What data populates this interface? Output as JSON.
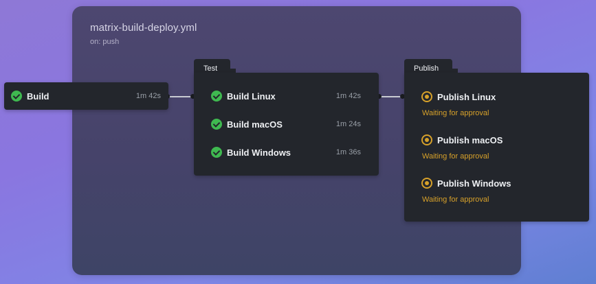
{
  "workflow": {
    "title": "matrix-build-deploy.yml",
    "trigger": "on: push"
  },
  "build_job": {
    "name": "Build",
    "duration": "1m 42s",
    "status": "success"
  },
  "test_group": {
    "label": "Test",
    "jobs": [
      {
        "name": "Build Linux",
        "duration": "1m 42s",
        "status": "success"
      },
      {
        "name": "Build macOS",
        "duration": "1m 24s",
        "status": "success"
      },
      {
        "name": "Build Windows",
        "duration": "1m 36s",
        "status": "success"
      }
    ]
  },
  "publish_group": {
    "label": "Publish",
    "jobs": [
      {
        "name": "Publish Linux",
        "status_text": "Waiting for approval",
        "status": "waiting"
      },
      {
        "name": "Publish macOS",
        "status_text": "Waiting for approval",
        "status": "waiting"
      },
      {
        "name": "Publish Windows",
        "status_text": "Waiting for approval",
        "status": "waiting"
      }
    ]
  },
  "colors": {
    "success": "#3fb950",
    "waiting": "#d7a12a",
    "card_bg": "#23262c"
  }
}
